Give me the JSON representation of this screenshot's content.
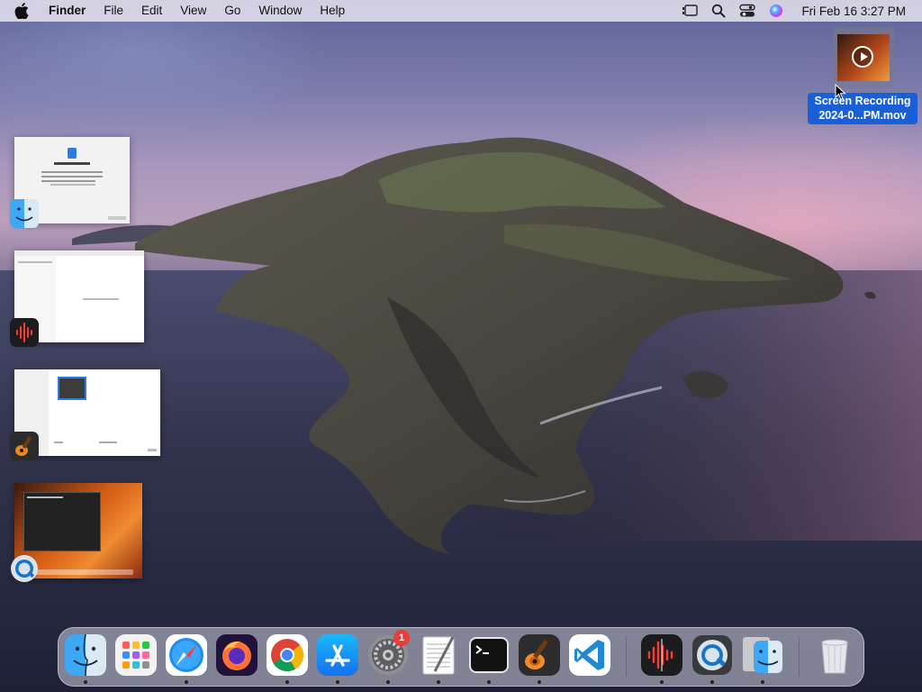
{
  "menubar": {
    "app_name": "Finder",
    "menus": [
      "File",
      "Edit",
      "View",
      "Go",
      "Window",
      "Help"
    ],
    "clock": "Fri Feb 16  3:27 PM",
    "status_icons": [
      "stage-manager-icon",
      "spotlight-search-icon",
      "control-center-icon",
      "siri-icon"
    ]
  },
  "desktop": {
    "file": {
      "label_line1": "Screen Recording",
      "label_line2": "2024-0...PM.mov",
      "icon": "video-file-icon"
    }
  },
  "stage_manager": {
    "groups": [
      {
        "app": "Finder",
        "icon": "finder-icon",
        "window_title": "Migration Assistant"
      },
      {
        "app": "Voice Memos",
        "icon": "voice-memos-icon",
        "window_title": "Voice Memos"
      },
      {
        "app": "GarageBand",
        "icon": "garageband-icon",
        "window_title": "GarageBand"
      },
      {
        "app": "QuickTime Player",
        "icon": "quicktime-icon",
        "window_title": "Terminal"
      }
    ]
  },
  "dock": {
    "items": [
      {
        "name": "Finder",
        "icon": "finder-icon",
        "running": true
      },
      {
        "name": "Launchpad",
        "icon": "launchpad-icon",
        "running": false
      },
      {
        "name": "Safari",
        "icon": "safari-icon",
        "running": true
      },
      {
        "name": "Firefox",
        "icon": "firefox-icon",
        "running": false
      },
      {
        "name": "Google Chrome",
        "icon": "chrome-icon",
        "running": true
      },
      {
        "name": "App Store",
        "icon": "app-store-icon",
        "running": true
      },
      {
        "name": "System Settings",
        "icon": "system-settings-icon",
        "running": true,
        "badge": "1"
      },
      {
        "name": "TextEdit",
        "icon": "textedit-icon",
        "running": true
      },
      {
        "name": "Terminal",
        "icon": "terminal-icon",
        "running": true
      },
      {
        "name": "GarageBand",
        "icon": "garageband-icon",
        "running": true
      },
      {
        "name": "Visual Studio Code",
        "icon": "vscode-icon",
        "running": false
      },
      {
        "name": "Voice Memos",
        "icon": "voice-memos-icon",
        "running": true
      },
      {
        "name": "QuickTime Player",
        "icon": "quicktime-icon",
        "running": true
      },
      {
        "name": "Finder (document)",
        "icon": "finder-icon",
        "running": true
      },
      {
        "name": "Trash",
        "icon": "trash-icon",
        "running": false
      }
    ]
  },
  "colors": {
    "selection_blue": "#1b5fd6",
    "badge_red": "#ee3b35"
  }
}
